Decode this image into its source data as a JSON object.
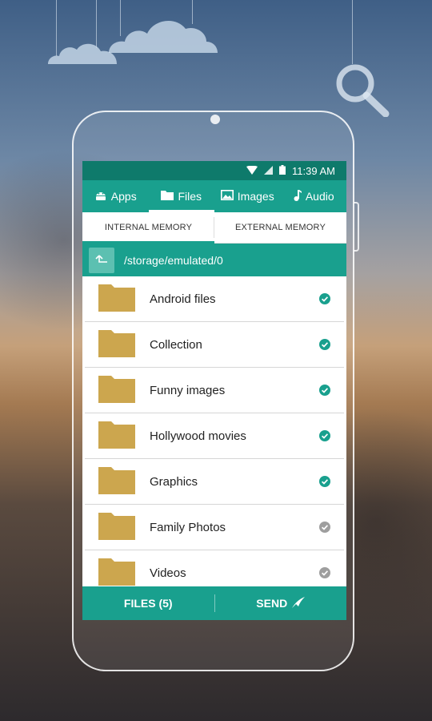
{
  "status_bar": {
    "time": "11:39 AM",
    "icons": [
      "wifi-icon",
      "signal-icon",
      "battery-icon"
    ]
  },
  "tabs": [
    {
      "label": "Apps",
      "icon": "android-icon",
      "active": false
    },
    {
      "label": "Files",
      "icon": "folder-icon",
      "active": true
    },
    {
      "label": "Images",
      "icon": "image-icon",
      "active": false
    },
    {
      "label": "Audio",
      "icon": "music-note-icon",
      "active": false
    }
  ],
  "storage_tabs": [
    {
      "label": "INTERNAL MEMORY",
      "active": true
    },
    {
      "label": "EXTERNAL MEMORY",
      "active": false
    }
  ],
  "path": "/storage/emulated/0",
  "files": [
    {
      "name": "Android files",
      "selected": true
    },
    {
      "name": "Collection",
      "selected": true
    },
    {
      "name": "Funny images",
      "selected": true
    },
    {
      "name": "Hollywood movies",
      "selected": true
    },
    {
      "name": "Graphics",
      "selected": true
    },
    {
      "name": "Family Photos",
      "selected": false
    },
    {
      "name": "Videos",
      "selected": false
    }
  ],
  "bottom_bar": {
    "files_label": "FILES (5)",
    "send_label": "SEND"
  },
  "colors": {
    "accent": "#19a08e",
    "status_bar": "#0e7a6b",
    "folder": "#cca64e",
    "check_selected": "#19a08e",
    "check_unselected": "#9e9e9e"
  }
}
